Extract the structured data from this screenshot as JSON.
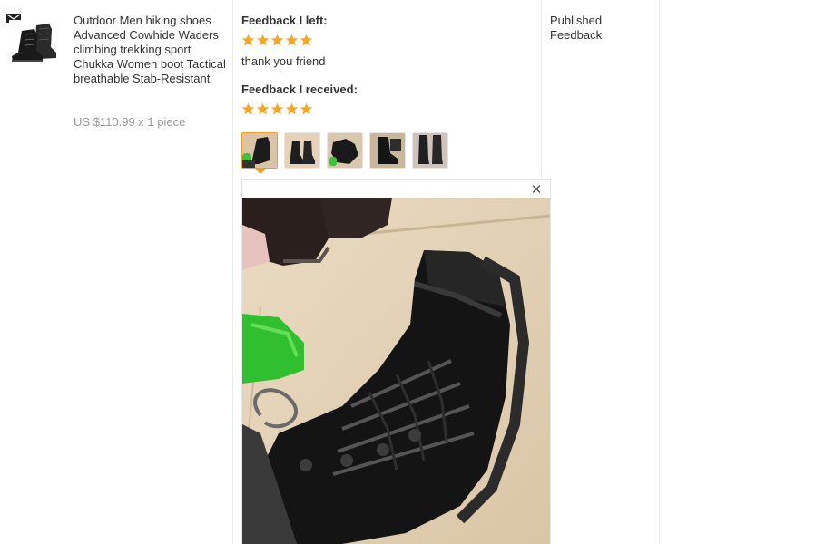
{
  "product": {
    "title": "Outdoor Men hiking shoes Advanced Cowhide Waders climbing trekking sport Chukka Women boot Tactical breathable Stab-Resistant",
    "price": "US $110.99 x 1 piece",
    "icon": "envelope-icon"
  },
  "feedback": {
    "left_heading": "Feedback I left:",
    "left_rating": 5,
    "left_text": "thank you friend",
    "received_heading": "Feedback I received:",
    "received_rating": 5,
    "photos_count": 5,
    "selected_photo": 1,
    "close_symbol": "✕"
  },
  "status": {
    "text": "Published Feedback"
  },
  "colors": {
    "star": "#f5a623",
    "selected_border": "#f0a020",
    "price": "#999999",
    "divider": "#ebebeb"
  }
}
